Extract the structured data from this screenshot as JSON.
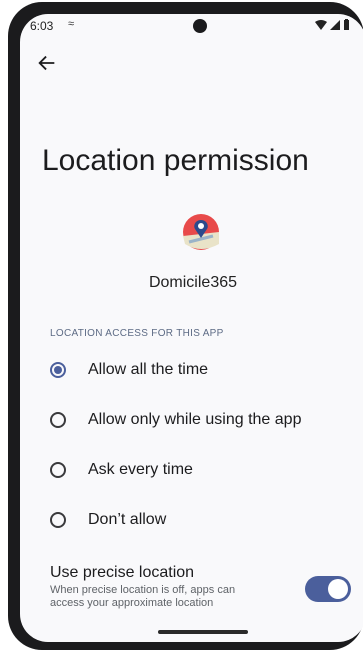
{
  "status_bar": {
    "time": "6:03",
    "mic_glyph": "≈"
  },
  "header": {
    "back_icon": "arrow-left"
  },
  "page": {
    "title": "Location permission"
  },
  "app": {
    "name": "Domicile365",
    "icon": "map-pin-icon"
  },
  "section": {
    "label": "LOCATION ACCESS FOR THIS APP"
  },
  "options": [
    {
      "label": "Allow all the time",
      "selected": true
    },
    {
      "label": "Allow only while using the app",
      "selected": false
    },
    {
      "label": "Ask every time",
      "selected": false
    },
    {
      "label": "Don’t allow",
      "selected": false
    }
  ],
  "precise": {
    "title": "Use precise location",
    "subtitle": "When precise location is off, apps can access your approximate location",
    "enabled": true
  },
  "colors": {
    "accent": "#4b5f9c",
    "background": "#f9f9fb"
  }
}
